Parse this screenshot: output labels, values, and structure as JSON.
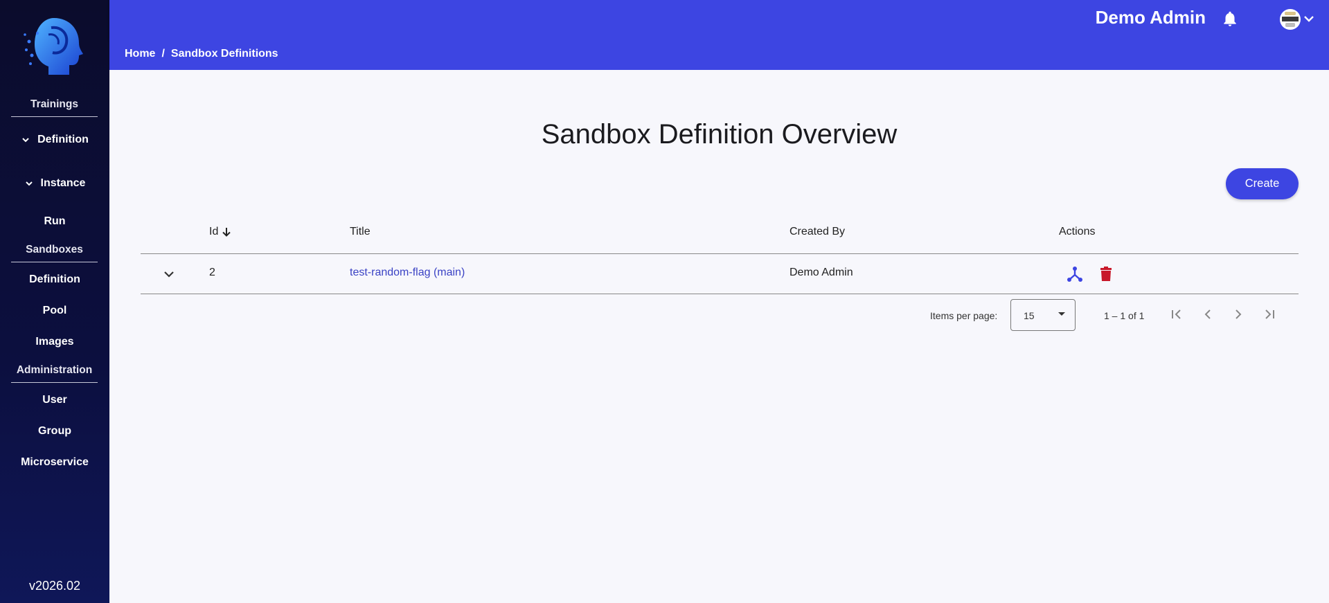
{
  "sidebar": {
    "sections": [
      {
        "label": "Trainings"
      },
      {
        "label": "Sandboxes"
      },
      {
        "label": "Administration"
      }
    ],
    "items": [
      {
        "label": "Definition",
        "icon": "chevron-down-icon"
      },
      {
        "label": "Instance",
        "icon": "chevron-down-icon"
      },
      {
        "label": "Run"
      },
      {
        "label": "Definition"
      },
      {
        "label": "Pool"
      },
      {
        "label": "Images"
      },
      {
        "label": "User"
      },
      {
        "label": "Group"
      },
      {
        "label": "Microservice"
      }
    ],
    "version": "v2026.02"
  },
  "header": {
    "username": "Demo Admin",
    "icons": [
      "bell-icon",
      "avatar",
      "chevron-down-icon"
    ]
  },
  "breadcrumb": {
    "home": "Home",
    "separator": "/",
    "current": "Sandbox Definitions"
  },
  "main": {
    "title": "Sandbox Definition Overview",
    "create_label": "Create"
  },
  "table": {
    "columns": {
      "id": "Id",
      "title": "Title",
      "created_by": "Created By",
      "actions": "Actions"
    },
    "sort_icon": "arrow-down-icon",
    "rows": [
      {
        "id": "2",
        "title": "test-random-flag (main)",
        "created_by": "Demo Admin"
      }
    ]
  },
  "paginator": {
    "items_per_page_label": "Items per page:",
    "items_per_page_value": "15",
    "range": "1 – 1 of 1"
  },
  "colors": {
    "primary": "#3d45e2",
    "sidebar_bg": "#0c0f3f",
    "delete": "#c8182a",
    "link": "#3a42c4"
  }
}
